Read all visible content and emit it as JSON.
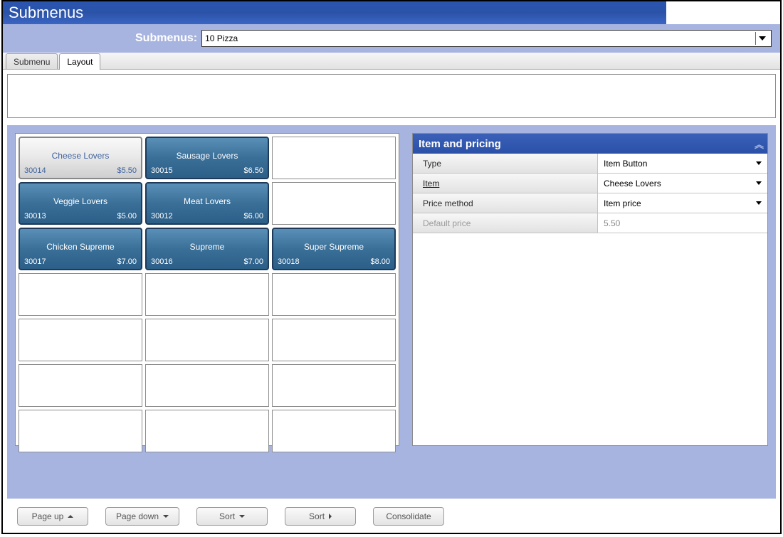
{
  "title": "Submenus",
  "toolbar": {
    "label": "Submenus:",
    "selected": "10 Pizza"
  },
  "tabs": [
    {
      "label": "Submenu",
      "active": false
    },
    {
      "label": "Layout",
      "active": true
    }
  ],
  "grid": {
    "rows": 7,
    "cols": 3,
    "items": [
      {
        "row": 0,
        "col": 0,
        "name": "Cheese Lovers",
        "code": "30014",
        "price": "$5.50",
        "selected": true
      },
      {
        "row": 0,
        "col": 1,
        "name": "Sausage Lovers",
        "code": "30015",
        "price": "$6.50"
      },
      {
        "row": 1,
        "col": 0,
        "name": "Veggie Lovers",
        "code": "30013",
        "price": "$5.00"
      },
      {
        "row": 1,
        "col": 1,
        "name": "Meat Lovers",
        "code": "30012",
        "price": "$6.00"
      },
      {
        "row": 2,
        "col": 0,
        "name": "Chicken Supreme",
        "code": "30017",
        "price": "$7.00"
      },
      {
        "row": 2,
        "col": 1,
        "name": "Supreme",
        "code": "30016",
        "price": "$7.00"
      },
      {
        "row": 2,
        "col": 2,
        "name": "Super Supreme",
        "code": "30018",
        "price": "$8.00"
      }
    ]
  },
  "properties": {
    "title": "Item and pricing",
    "rows": [
      {
        "label": "Type",
        "value": "Item Button",
        "dropdown": true
      },
      {
        "label": "Item",
        "value": "Cheese Lovers",
        "dropdown": true,
        "link": true
      },
      {
        "label": "Price method",
        "value": "Item price",
        "dropdown": true
      },
      {
        "label": "Default price",
        "value": "5.50",
        "dropdown": false,
        "disabled": true
      }
    ]
  },
  "footer": {
    "page_up": "Page up",
    "page_down": "Page down",
    "sort1": "Sort",
    "sort2": "Sort",
    "consolidate": "Consolidate"
  }
}
